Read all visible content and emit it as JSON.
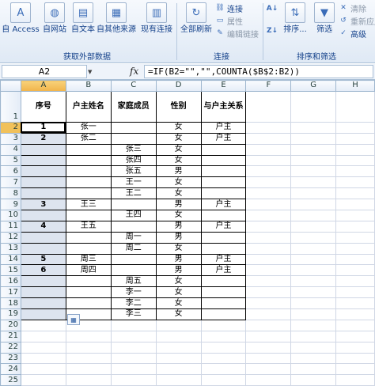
{
  "ribbon": {
    "external_group": {
      "label": "获取外部数据",
      "buttons": [
        {
          "name": "access",
          "label": "自 Access",
          "icon": "access-icon"
        },
        {
          "name": "web",
          "label": "自网站",
          "icon": "web-icon"
        },
        {
          "name": "text",
          "label": "自文本",
          "icon": "text-file-icon"
        },
        {
          "name": "other",
          "label": "自其他来源",
          "icon": "other-sources-icon"
        },
        {
          "name": "existing",
          "label": "现有连接",
          "icon": "existing-connections-icon"
        }
      ]
    },
    "connections_group": {
      "label": "连接",
      "refresh_label": "全部刷新",
      "items": [
        "连接",
        "属性",
        "编辑链接"
      ]
    },
    "sort_group": {
      "label": "排序和筛选",
      "sort_label": "排序...",
      "filter_label": "筛选",
      "items": [
        "清除",
        "重新应用",
        "高级"
      ]
    }
  },
  "formula_bar": {
    "name_box": "A2",
    "fx": "fx",
    "formula": "=IF(B2=\"\",\"\",COUNTA($B$2:B2))"
  },
  "sheet": {
    "columns": [
      "A",
      "B",
      "C",
      "D",
      "E",
      "F",
      "G",
      "H"
    ],
    "header": {
      "seq": "序号",
      "owner": "户主姓名",
      "member": "家庭成员",
      "gender": "性别",
      "relation": "与户主关系"
    },
    "rows": [
      {
        "num": "2",
        "seq": "1",
        "owner": "张一",
        "member": "",
        "gender": "女",
        "relation": "户主"
      },
      {
        "num": "3",
        "seq": "2",
        "owner": "张二",
        "member": "",
        "gender": "女",
        "relation": "户主"
      },
      {
        "num": "4",
        "seq": "",
        "owner": "",
        "member": "张三",
        "gender": "女",
        "relation": ""
      },
      {
        "num": "5",
        "seq": "",
        "owner": "",
        "member": "张四",
        "gender": "女",
        "relation": ""
      },
      {
        "num": "6",
        "seq": "",
        "owner": "",
        "member": "张五",
        "gender": "男",
        "relation": ""
      },
      {
        "num": "7",
        "seq": "",
        "owner": "",
        "member": "王一",
        "gender": "女",
        "relation": ""
      },
      {
        "num": "8",
        "seq": "",
        "owner": "",
        "member": "王二",
        "gender": "女",
        "relation": ""
      },
      {
        "num": "9",
        "seq": "3",
        "owner": "王三",
        "member": "",
        "gender": "男",
        "relation": "户主"
      },
      {
        "num": "10",
        "seq": "",
        "owner": "",
        "member": "王四",
        "gender": "女",
        "relation": ""
      },
      {
        "num": "11",
        "seq": "4",
        "owner": "王五",
        "member": "",
        "gender": "男",
        "relation": "户主"
      },
      {
        "num": "12",
        "seq": "",
        "owner": "",
        "member": "周一",
        "gender": "男",
        "relation": ""
      },
      {
        "num": "13",
        "seq": "",
        "owner": "",
        "member": "周二",
        "gender": "女",
        "relation": ""
      },
      {
        "num": "14",
        "seq": "5",
        "owner": "周三",
        "member": "",
        "gender": "男",
        "relation": "户主"
      },
      {
        "num": "15",
        "seq": "6",
        "owner": "周四",
        "member": "",
        "gender": "男",
        "relation": "户主"
      },
      {
        "num": "16",
        "seq": "",
        "owner": "",
        "member": "周五",
        "gender": "女",
        "relation": ""
      },
      {
        "num": "17",
        "seq": "",
        "owner": "",
        "member": "李一",
        "gender": "女",
        "relation": ""
      },
      {
        "num": "18",
        "seq": "",
        "owner": "",
        "member": "李二",
        "gender": "女",
        "relation": ""
      },
      {
        "num": "19",
        "seq": "",
        "owner": "",
        "member": "李三",
        "gender": "女",
        "relation": ""
      }
    ],
    "empty_rows": [
      "20",
      "21",
      "22",
      "23",
      "24",
      "25"
    ]
  }
}
